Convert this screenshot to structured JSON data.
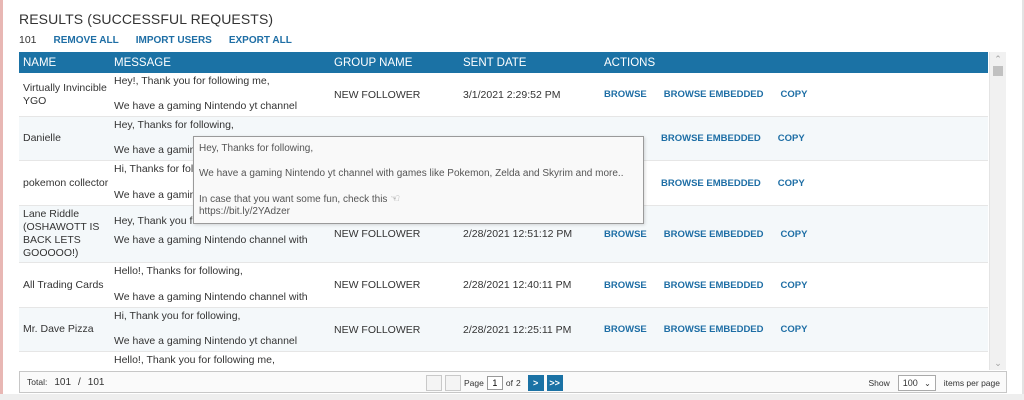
{
  "title": "RESULTS (SUCCESSFUL REQUESTS)",
  "toolbar": {
    "count": "101",
    "remove_all": "REMOVE ALL",
    "import_users": "IMPORT USERS",
    "export_all": "EXPORT ALL"
  },
  "columns": {
    "name": "NAME",
    "message": "MESSAGE",
    "group": "GROUP NAME",
    "date": "SENT DATE",
    "actions": "ACTIONS"
  },
  "actions": {
    "browse": "BROWSE",
    "browse_embedded": "BROWSE EMBEDDED",
    "copy": "COPY"
  },
  "rows": [
    {
      "name": "Virtually Invincible YGO",
      "msg1": "Hey!, Thank you for following me,",
      "msg2": "We have a gaming Nintendo yt channel",
      "group": "NEW FOLLOWER",
      "date": "3/1/2021 2:29:52 PM"
    },
    {
      "name": "Danielle",
      "msg1": "Hey, Thanks for following,",
      "msg2": "We have a gaming",
      "group": "",
      "date": ""
    },
    {
      "name": "pokemon collector",
      "msg1": "Hi, Thanks for fol",
      "msg2": "We have a gamin",
      "group": "",
      "date": ""
    },
    {
      "name": "Lane Riddle (OSHAWOTT IS BACK LETS GOOOOO!)",
      "msg1": "Hey, Thank you f",
      "msg2": "We have a gaming Nintendo channel with",
      "group": "NEW FOLLOWER",
      "date": "2/28/2021 12:51:12 PM"
    },
    {
      "name": "All Trading Cards",
      "msg1": "Hello!, Thanks for following,",
      "msg2": "We have a gaming Nintendo channel with",
      "group": "NEW FOLLOWER",
      "date": "2/28/2021 12:40:11 PM"
    },
    {
      "name": "Mr. Dave Pizza",
      "msg1": "Hi, Thank you for following,",
      "msg2": "We have a gaming Nintendo yt channel",
      "group": "NEW FOLLOWER",
      "date": "2/28/2021 12:25:11 PM"
    },
    {
      "name": "",
      "msg1": "Hello!, Thank you for following me,",
      "msg2": "",
      "group": "",
      "date": ""
    }
  ],
  "tooltip": {
    "line1": "Hey, Thanks for following,",
    "line2": "We have a gaming Nintendo yt channel with games like Pokemon, Zelda and Skyrim and more..",
    "line3": "In case that you want some fun, check this",
    "line4": "https://bit.ly/2YAdzer"
  },
  "footer": {
    "total_label": "Total:",
    "total_shown": "101",
    "separator": "/",
    "total_all": "101",
    "page_label": "Page",
    "page_value": "1",
    "of_label": "of",
    "page_count": "2",
    "show_label": "Show",
    "per_page": "100",
    "items_label": "items per page",
    "next": ">",
    "last": ">>"
  },
  "colors": {
    "header_bg": "#1b72a5",
    "link": "#1e6ea5"
  }
}
